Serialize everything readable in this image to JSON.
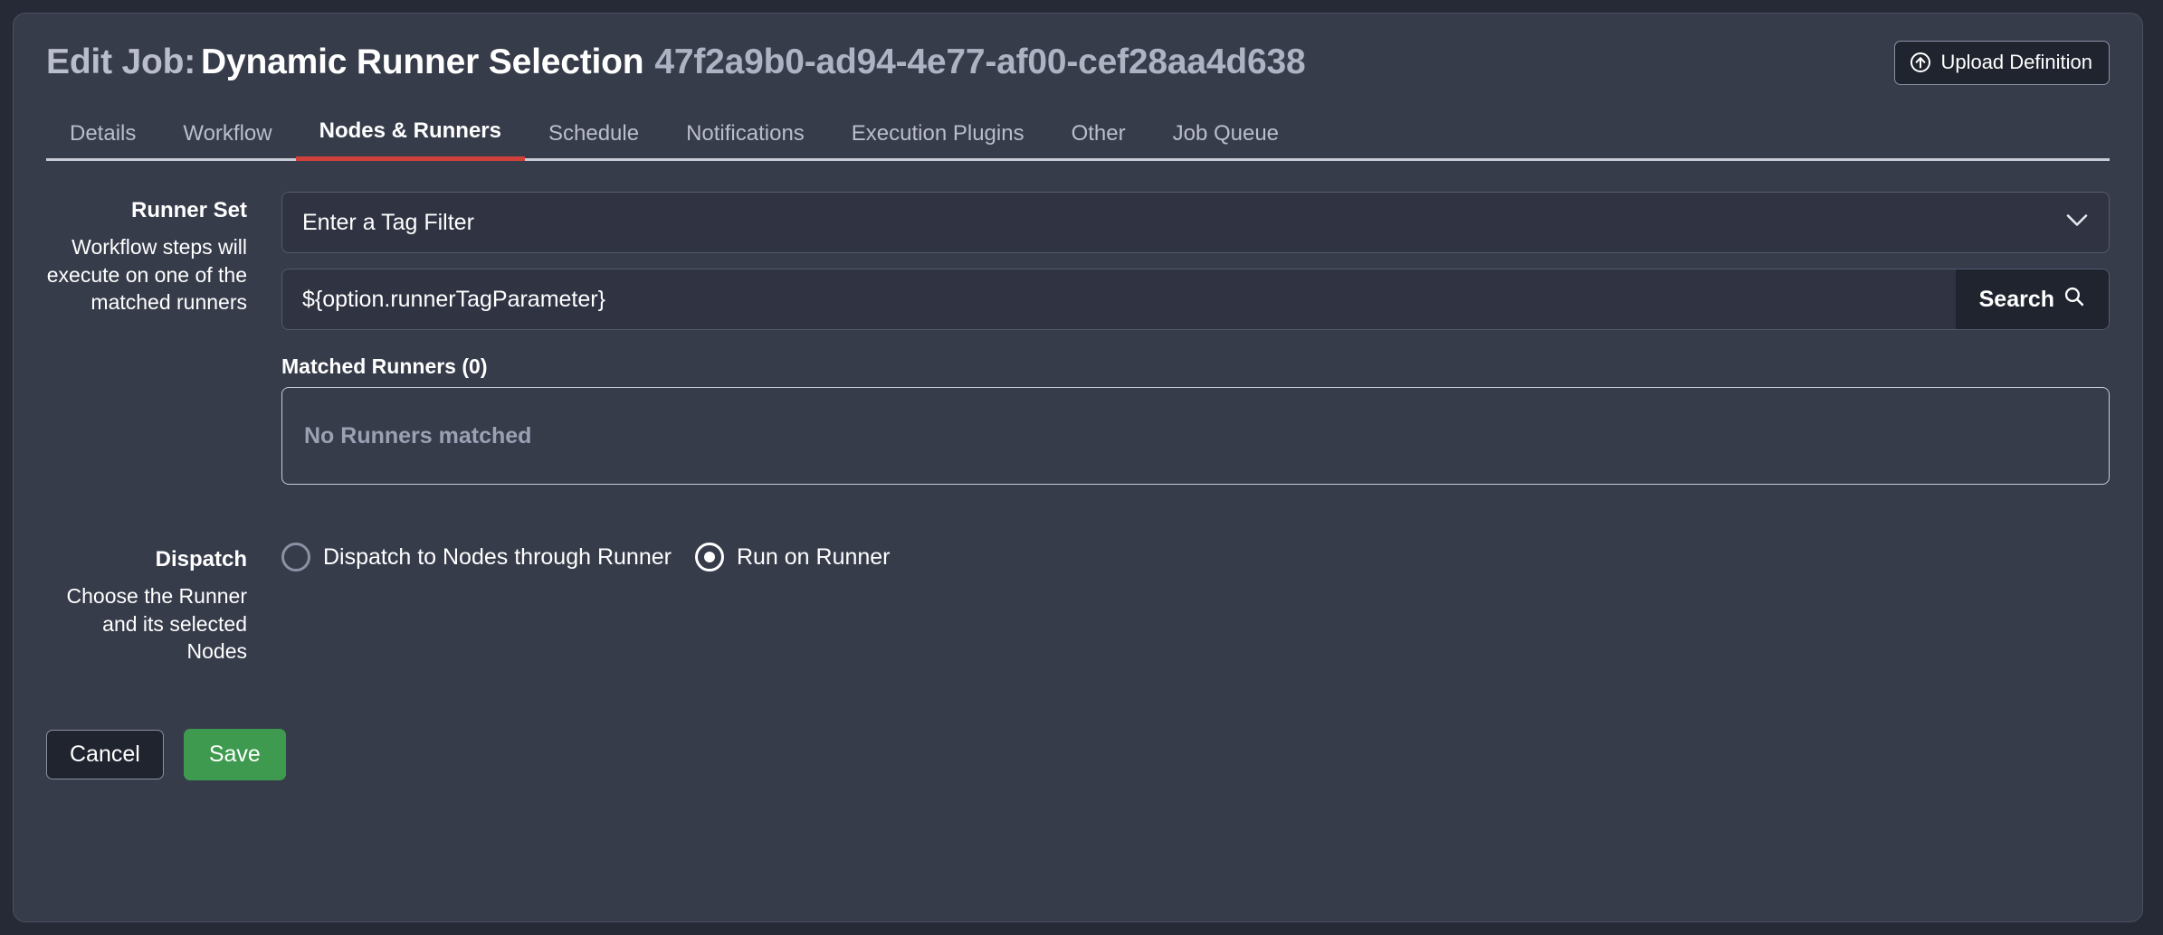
{
  "header": {
    "title_prefix": "Edit Job:",
    "job_name": "Dynamic Runner Selection",
    "job_uuid": "47f2a9b0-ad94-4e77-af00-cef28aa4d638",
    "upload_button": "Upload Definition",
    "upload_icon": "upload-circle-icon"
  },
  "tabs": [
    {
      "label": "Details",
      "active": false
    },
    {
      "label": "Workflow",
      "active": false
    },
    {
      "label": "Nodes & Runners",
      "active": true
    },
    {
      "label": "Schedule",
      "active": false
    },
    {
      "label": "Notifications",
      "active": false
    },
    {
      "label": "Execution Plugins",
      "active": false
    },
    {
      "label": "Other",
      "active": false
    },
    {
      "label": "Job Queue",
      "active": false
    }
  ],
  "runner_set": {
    "label": "Runner Set",
    "description": "Workflow steps will execute on one of the matched runners",
    "tag_filter_select": "Enter a Tag Filter",
    "tag_filter_icon": "chevron-down-icon",
    "search_value": "${option.runnerTagParameter}",
    "search_placeholder": "Enter a Tag Filter",
    "search_button": "Search",
    "search_icon": "search-icon",
    "matched_title": "Matched Runners (0)",
    "matched_empty": "No Runners matched"
  },
  "dispatch": {
    "label": "Dispatch",
    "description": "Choose the Runner and its selected Nodes",
    "options": [
      {
        "label": "Dispatch to Nodes through Runner",
        "selected": false
      },
      {
        "label": "Run on Runner",
        "selected": true
      }
    ]
  },
  "footer": {
    "cancel_label": "Cancel",
    "save_label": "Save"
  },
  "colors": {
    "page_background": "#262a36",
    "card_background": "#373c4b",
    "accent_red": "#d0413b",
    "save_green": "#3d9a4e",
    "muted_text": "#b9bdcc"
  }
}
